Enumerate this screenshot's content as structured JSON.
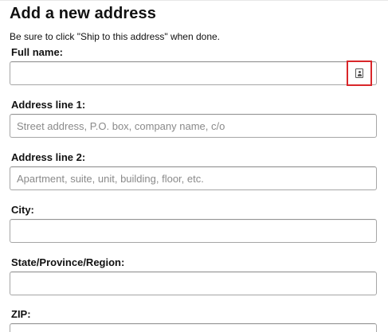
{
  "form": {
    "title": "Add a new address",
    "instructions": "Be sure to click \"Ship to this address\" when done."
  },
  "fields": {
    "full_name": {
      "label": "Full name:",
      "value": "",
      "placeholder": ""
    },
    "address_line_1": {
      "label": "Address line 1:",
      "value": "",
      "placeholder": "Street address, P.O. box, company name, c/o"
    },
    "address_line_2": {
      "label": "Address line 2:",
      "value": "",
      "placeholder": "Apartment, suite, unit, building, floor, etc."
    },
    "city": {
      "label": "City:",
      "value": "",
      "placeholder": ""
    },
    "state": {
      "label": "State/Province/Region:",
      "value": "",
      "placeholder": ""
    },
    "zip": {
      "label": "ZIP:",
      "value": "",
      "placeholder": ""
    }
  },
  "contact_picker": {
    "icon": "contact-card-icon",
    "highlight_color": "#d9262a"
  }
}
